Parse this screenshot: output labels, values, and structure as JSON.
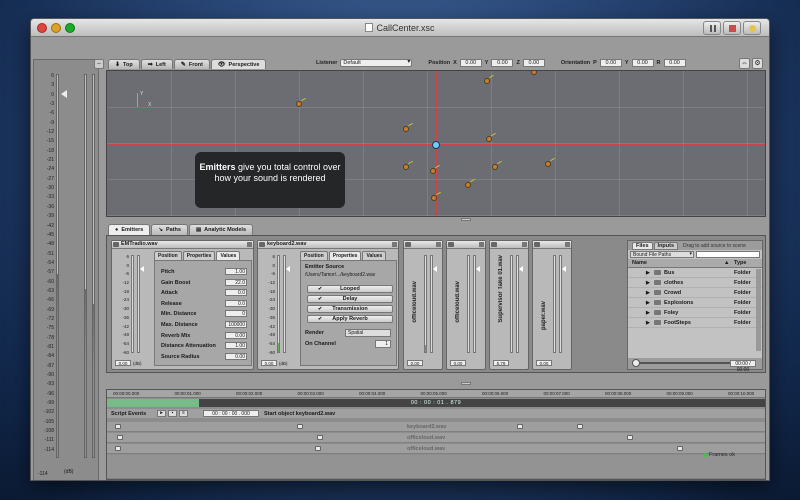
{
  "window": {
    "title": "CallCenter.xsc"
  },
  "master": {
    "scale": [
      "6",
      "3",
      "0",
      "-3",
      "-6",
      "-9",
      "-12",
      "-15",
      "-18",
      "-21",
      "-24",
      "-27",
      "-30",
      "-33",
      "-36",
      "-39",
      "-42",
      "-45",
      "-48",
      "-51",
      "-54",
      "-57",
      "-60",
      "-63",
      "-66",
      "-69",
      "-72",
      "-75",
      "-78",
      "-81",
      "-84",
      "-87",
      "-90",
      "-93",
      "-96",
      "-99",
      "-102",
      "-105",
      "-108",
      "-111",
      "-114"
    ],
    "value": "-114",
    "unit": "(dB)"
  },
  "view_tabs": [
    {
      "label": "Top",
      "icon": "⬇"
    },
    {
      "label": "Left",
      "icon": "➡"
    },
    {
      "label": "Front",
      "icon": "✎"
    },
    {
      "label": "Perspective",
      "icon": "👁"
    }
  ],
  "listener_bar": {
    "listener_label": "Listener",
    "listener_value": "Default",
    "position_label": "Position",
    "x_label": "X",
    "x_value": "0.00",
    "y_label": "Y",
    "y_value": "0.00",
    "z_label": "Z",
    "z_value": "0.00",
    "orientation_label": "Orientation",
    "p_label": "P",
    "p_value": "0.00",
    "y2_label": "Y",
    "y2_value": "0.00",
    "r_label": "R",
    "r_value": "0.00"
  },
  "scene": {
    "axis_y_label": "Y",
    "axis_x_label": "X",
    "tooltip_bold": "Emitters",
    "tooltip_rest": " give you total control over how your sound is rendered"
  },
  "lower_tabs": [
    {
      "label": "Emitters",
      "icon": "●"
    },
    {
      "label": "Paths",
      "icon": "↘"
    },
    {
      "label": "Analytic Models",
      "icon": "▤"
    }
  ],
  "strips": {
    "scale": [
      "6",
      "0",
      "-6",
      "-12",
      "-18",
      "-24",
      "-30",
      "-36",
      "-42",
      "-48",
      "-54",
      "-60"
    ],
    "value": "0.00",
    "unit": "(dB)",
    "emtradio": {
      "name": "EMTradio.wav",
      "tabs": [
        "Position",
        "Properties",
        "Values"
      ],
      "props": [
        {
          "label": "Pitch",
          "value": "1.00"
        },
        {
          "label": "Gain Boost",
          "value": "22.0"
        },
        {
          "label": "Attack",
          "value": "0.0"
        },
        {
          "label": "Release",
          "value": "0.0"
        },
        {
          "label": "Min. Distance",
          "value": "0"
        },
        {
          "label": "Max. Distance",
          "value": "100000"
        },
        {
          "label": "Reverb Mix",
          "value": "0.00"
        },
        {
          "label": "Distance Attenuation",
          "value": "1.00"
        },
        {
          "label": "Source Radius",
          "value": "0.00"
        }
      ]
    },
    "keyboard2": {
      "name": "keyboard2.wav",
      "tabs": [
        "Position",
        "Properties",
        "Values"
      ],
      "source_label": "Emitter Source",
      "source_path": "/Users/Tamor/.../keyboard2.wav",
      "checks": [
        "Looped",
        "Delay",
        "Transmission",
        "Apply Reverb"
      ],
      "render_label": "Render",
      "render_value": "Spatial",
      "channel_label": "On Channel",
      "channel_value": "1"
    },
    "small": [
      {
        "name": "officeloud.wav",
        "value": "0.00"
      },
      {
        "name": "officeloud.wav",
        "value": "0.00"
      },
      {
        "name": "Supervisor Take 01.wav",
        "value": "5.79"
      },
      {
        "name": "paper.wav",
        "value": "0.00"
      }
    ]
  },
  "files": {
    "tabs": [
      "Files",
      "Inputs"
    ],
    "hint": "Drag to add source to scene",
    "bound_select": "Bound File Paths",
    "col_name": "Name",
    "col_type": "Type",
    "rows": [
      {
        "name": "Bus",
        "type": "Folder"
      },
      {
        "name": "clothes",
        "type": "Folder"
      },
      {
        "name": "Crowd",
        "type": "Folder"
      },
      {
        "name": "Explosions",
        "type": "Folder"
      },
      {
        "name": "Foley",
        "type": "Folder"
      },
      {
        "name": "FootSteps",
        "type": "Folder"
      }
    ],
    "time": "00:00 / 00:00"
  },
  "timeline": {
    "ticks": [
      "00:00:00.000",
      "00:00:01.000",
      "00:00:02.000",
      "00:00:03.000",
      "00:00:04.000",
      "00:00:05.000",
      "00:00:06.000",
      "00:00:07.000",
      "00:00:08.000",
      "00:00:09.000",
      "00:00:10.000"
    ],
    "progress_text": "00 : 00 : 01 . 879",
    "progress_fraction": 0.14,
    "script_label": "Script Events",
    "script_time": "00 : 00 : 00 . 000",
    "script_text": "Start object keyboard2.wav",
    "tracks": [
      "keyboard2.wav",
      "officeloud.wav",
      "officeloud.wav"
    ]
  },
  "status": {
    "text": "Frames ok"
  },
  "colors": {
    "axis": "#cc4444",
    "emitter": "#d07a2a",
    "listener": "#6ad0ff",
    "meter": "#66aa55"
  }
}
